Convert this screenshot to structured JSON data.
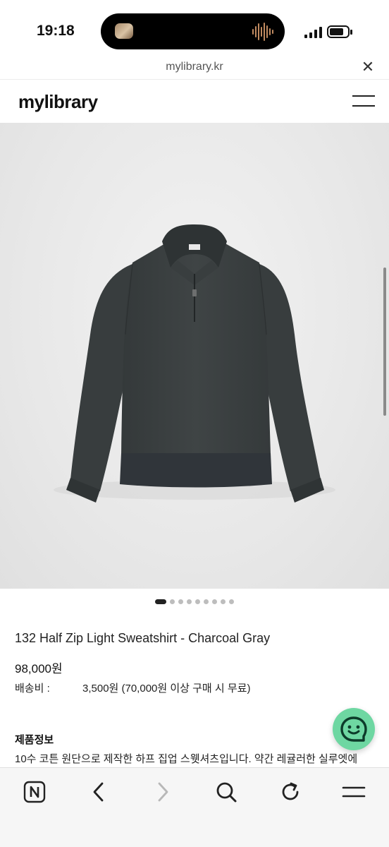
{
  "status_bar": {
    "time": "19:18"
  },
  "browser": {
    "url": "mylibrary.kr",
    "close_glyph": "✕"
  },
  "site": {
    "logo": "mylibrary"
  },
  "carousel": {
    "total_slides": 9,
    "active_index": 0
  },
  "product": {
    "name": "132 Half Zip Light Sweatshirt - Charcoal Gray",
    "price": "98,000원",
    "shipping_label": "배송비 :",
    "shipping_value": "3,500원 (70,000원 이상 구매 시 무료)",
    "info_heading": "제품정보",
    "info_description": "10수 코튼 원단으로 제작한 하프 집업 스웻셔츠입니다. 약간 레귤러한 실루엣에"
  },
  "colors": {
    "sweatshirt": "#3b3f3f",
    "chat_button": "#6ed7a2",
    "toolbar_bg": "#f6f6f6"
  },
  "toolbar": {
    "icons": [
      "naver-icon",
      "back-icon",
      "forward-icon",
      "search-icon",
      "reload-icon",
      "menu-icon"
    ]
  }
}
